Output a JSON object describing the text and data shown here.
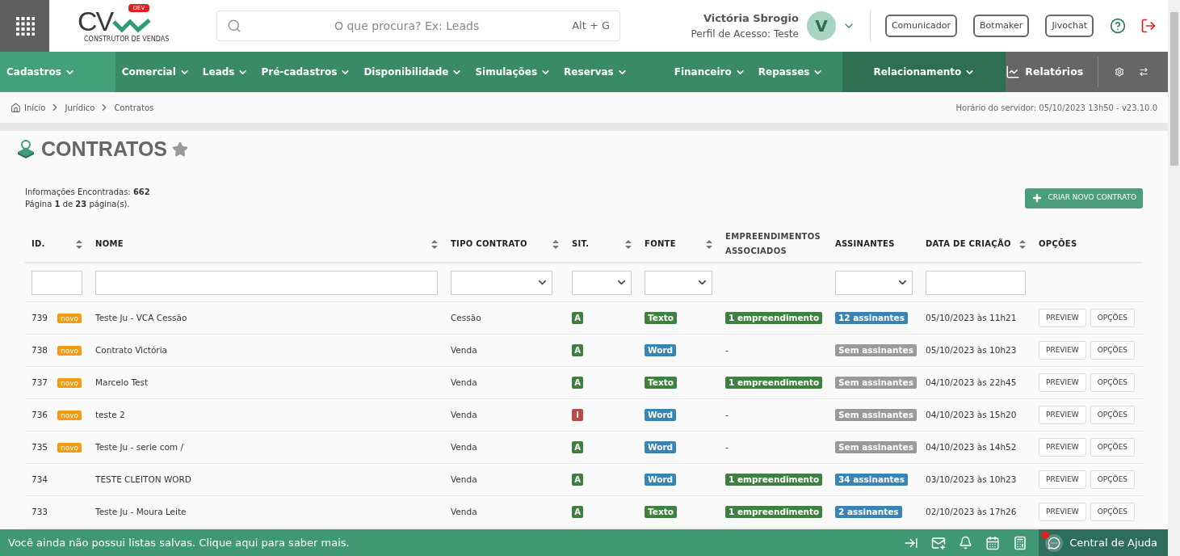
{
  "header": {
    "logo": {
      "letters": "CV",
      "badge": "DEV",
      "tagline": "CONSTRUTOR DE VENDAS"
    },
    "search": {
      "placeholder": "O que procura? Ex: Leads",
      "shortcut": "Alt + G"
    },
    "user": {
      "name": "Victória Sbrogio",
      "profile": "Perfil de Acesso: Teste",
      "initial": "V"
    },
    "buttons": [
      "Comunicador",
      "Botmaker",
      "Jivochat"
    ]
  },
  "nav": {
    "items": [
      {
        "label": "Cadastros",
        "kind": "main",
        "selected": true
      },
      {
        "label": "Comercial",
        "kind": "main",
        "selected": false
      },
      {
        "label": "Leads",
        "kind": "main",
        "selected": false
      },
      {
        "label": "Pré-cadastros",
        "kind": "main",
        "selected": false
      },
      {
        "label": "Disponibilidade",
        "kind": "main",
        "selected": false
      },
      {
        "label": "Simulações",
        "kind": "main",
        "selected": false
      },
      {
        "label": "Reservas",
        "kind": "main",
        "selected": false
      },
      {
        "label": "Financeiro",
        "kind": "main",
        "selected": false
      },
      {
        "label": "Repasses",
        "kind": "main",
        "selected": false
      },
      {
        "label": "Relacionamento",
        "kind": "relationship",
        "selected": false
      }
    ],
    "reports": "Relatórios"
  },
  "breadcrumb": [
    "Início",
    "Jurídico",
    "Contratos"
  ],
  "server_time": "Horário do servidor: 05/10/2023 13h50 - v23.10.0",
  "page": {
    "title": "CONTRATOS",
    "favorite": false,
    "found": "Informações Encontradas: **662**",
    "pages": "Página **1** de **23** página(s).",
    "create_button": "CRIAR NOVO CONTRATO"
  },
  "table": {
    "columns": [
      {
        "label": "ID.",
        "sortable": true,
        "filter": {
          "kind": "text"
        }
      },
      {
        "label": "NOME",
        "sortable": true,
        "filter": {
          "kind": "text"
        }
      },
      {
        "label": "TIPO CONTRATO",
        "sortable": true,
        "filter": {
          "kind": "select"
        }
      },
      {
        "label": "SIT.",
        "sortable": true,
        "filter": {
          "kind": "select"
        }
      },
      {
        "label": "FONTE",
        "sortable": true,
        "filter": {
          "kind": "select"
        }
      },
      {
        "label": "EMPREENDIMENTOS ASSOCIADOS",
        "sortable": false
      },
      {
        "label": "ASSINANTES",
        "sortable": false,
        "filter": {
          "kind": "select"
        }
      },
      {
        "label": "DATA DE CRIAÇÃO",
        "sortable": true,
        "filter": {
          "kind": "text"
        }
      },
      {
        "label": "OPÇÕES",
        "sortable": false
      }
    ],
    "rows": [
      {
        "id": "739",
        "tag": "novo",
        "name": "Teste Ju - VCA Cessão",
        "type": "Cessão",
        "status": {
          "text": "A",
          "color": "#3f7f3f"
        },
        "source": {
          "text": "Texto",
          "color": "#3f7f3f"
        },
        "projects": {
          "text": "1 empreendimento",
          "color": "#3f7f3f"
        },
        "signers": {
          "text": "12 assinantes",
          "color": "#3a84b5"
        },
        "created": "05/10/2023 às 11h21",
        "actions": [
          "PREVIEW",
          "OPÇÕES"
        ]
      },
      {
        "id": "738",
        "tag": "novo",
        "name": "Contrato Victória",
        "type": "Venda",
        "status": {
          "text": "A",
          "color": "#3f7f3f"
        },
        "source": {
          "text": "Word",
          "color": "#3a84b5"
        },
        "projects": {
          "text": "-"
        },
        "signers": {
          "text": "Sem assinantes",
          "color": "#999999"
        },
        "created": "05/10/2023 às 10h23",
        "actions": [
          "PREVIEW",
          "OPÇÕES"
        ]
      },
      {
        "id": "737",
        "tag": "novo",
        "name": "Marcelo Test",
        "type": "Venda",
        "status": {
          "text": "A",
          "color": "#3f7f3f"
        },
        "source": {
          "text": "Texto",
          "color": "#3f7f3f"
        },
        "projects": {
          "text": "1 empreendimento",
          "color": "#3f7f3f"
        },
        "signers": {
          "text": "Sem assinantes",
          "color": "#999999"
        },
        "created": "04/10/2023 às 22h45",
        "actions": [
          "PREVIEW",
          "OPÇÕES"
        ]
      },
      {
        "id": "736",
        "tag": "novo",
        "name": "teste 2",
        "type": "Venda",
        "status": {
          "text": "I",
          "color": "#b94a48"
        },
        "source": {
          "text": "Word",
          "color": "#3a84b5"
        },
        "projects": {
          "text": "-"
        },
        "signers": {
          "text": "Sem assinantes",
          "color": "#999999"
        },
        "created": "04/10/2023 às 15h20",
        "actions": [
          "PREVIEW",
          "OPÇÕES"
        ]
      },
      {
        "id": "735",
        "tag": "novo",
        "name": "Teste Ju - serie com /",
        "type": "Venda",
        "status": {
          "text": "A",
          "color": "#3f7f3f"
        },
        "source": {
          "text": "Word",
          "color": "#3a84b5"
        },
        "projects": {
          "text": "-"
        },
        "signers": {
          "text": "Sem assinantes",
          "color": "#999999"
        },
        "created": "04/10/2023 às 14h52",
        "actions": [
          "PREVIEW",
          "OPÇÕES"
        ]
      },
      {
        "id": "734",
        "name": "TESTE CLEITON WORD",
        "type": "Venda",
        "status": {
          "text": "A",
          "color": "#3f7f3f"
        },
        "source": {
          "text": "Word",
          "color": "#3a84b5"
        },
        "projects": {
          "text": "1 empreendimento",
          "color": "#3f7f3f"
        },
        "signers": {
          "text": "34 assinantes",
          "color": "#3a84b5"
        },
        "created": "03/10/2023 às 10h23",
        "actions": [
          "PREVIEW",
          "OPÇÕES"
        ]
      },
      {
        "id": "733",
        "name": "Teste Ju - Moura Leite",
        "type": "Venda",
        "status": {
          "text": "A",
          "color": "#3f7f3f"
        },
        "source": {
          "text": "Texto",
          "color": "#3f7f3f"
        },
        "projects": {
          "text": "1 empreendimento",
          "color": "#3f7f3f"
        },
        "signers": {
          "text": "2 assinantes",
          "color": "#3a84b5"
        },
        "created": "02/10/2023 às 17h26",
        "actions": [
          "PREVIEW",
          "OPÇÕES"
        ]
      }
    ]
  },
  "footer": {
    "message": "Você ainda não possui listas salvas. Clique aqui para saber mais.",
    "help": "Central de Ajuda"
  }
}
